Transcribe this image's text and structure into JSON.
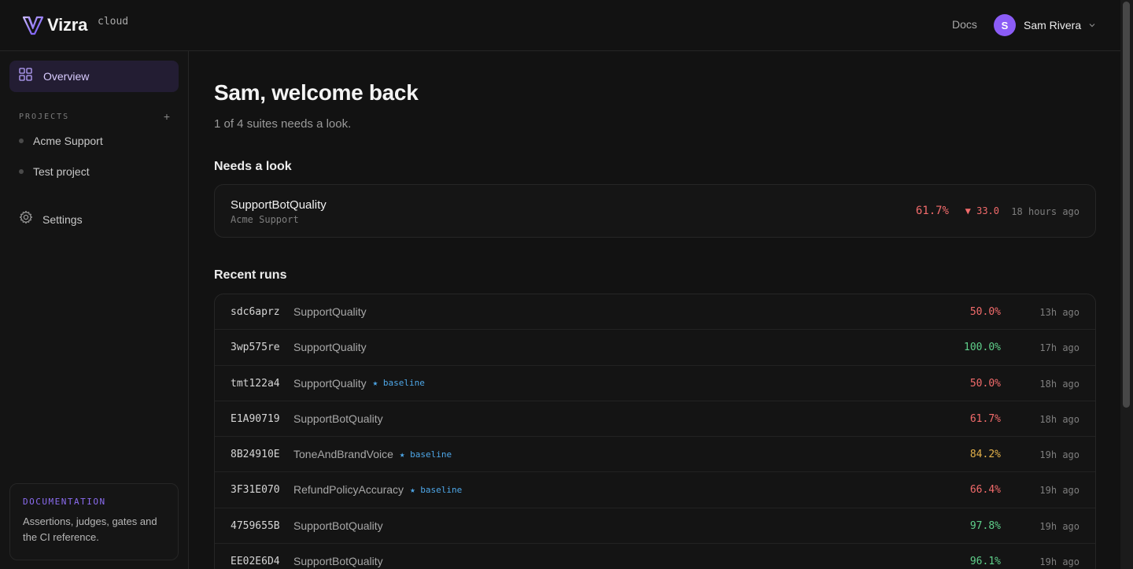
{
  "header": {
    "brand_name": "Vizra",
    "brand_tag": "cloud",
    "docs_label": "Docs",
    "user_initial": "S",
    "user_name": "Sam Rivera"
  },
  "sidebar": {
    "overview_label": "Overview",
    "projects_heading": "PROJECTS",
    "add_project": "+",
    "projects": [
      {
        "label": "Acme Support"
      },
      {
        "label": "Test project"
      }
    ],
    "settings_label": "Settings",
    "doc_card": {
      "title": "DOCUMENTATION",
      "description": "Assertions, judges, gates and the CI reference."
    }
  },
  "main": {
    "greeting": "Sam, welcome back",
    "summary": "1 of 4 suites needs a look.",
    "needs_heading": "Needs a look",
    "needs_item": {
      "suite": "SupportBotQuality",
      "project": "Acme Support",
      "score": "61.7%",
      "delta": "▼ 33.0",
      "time": "18 hours ago"
    },
    "runs_heading": "Recent runs",
    "runs": [
      {
        "id": "sdc6aprz",
        "suite": "SupportQuality",
        "baseline": "",
        "score": "50.0%",
        "status": "bad",
        "time": "13h ago"
      },
      {
        "id": "3wp575re",
        "suite": "SupportQuality",
        "baseline": "",
        "score": "100.0%",
        "status": "good",
        "time": "17h ago"
      },
      {
        "id": "tmt122a4",
        "suite": "SupportQuality",
        "baseline": "★ baseline",
        "score": "50.0%",
        "status": "bad",
        "time": "18h ago"
      },
      {
        "id": "E1A90719",
        "suite": "SupportBotQuality",
        "baseline": "",
        "score": "61.7%",
        "status": "bad",
        "time": "18h ago"
      },
      {
        "id": "8B24910E",
        "suite": "ToneAndBrandVoice",
        "baseline": "★ baseline",
        "score": "84.2%",
        "status": "warn",
        "time": "19h ago"
      },
      {
        "id": "3F31E070",
        "suite": "RefundPolicyAccuracy",
        "baseline": "★ baseline",
        "score": "66.4%",
        "status": "bad",
        "time": "19h ago"
      },
      {
        "id": "4759655B",
        "suite": "SupportBotQuality",
        "baseline": "",
        "score": "97.8%",
        "status": "good",
        "time": "19h ago"
      },
      {
        "id": "EE02E6D4",
        "suite": "SupportBotQuality",
        "baseline": "",
        "score": "96.1%",
        "status": "good",
        "time": "19h ago"
      }
    ]
  },
  "colors": {
    "accent": "#8b5cf6",
    "bad": "#f26b6b",
    "good": "#5fcf8a",
    "warn": "#e2b04a",
    "baseline": "#4ea7e8"
  }
}
